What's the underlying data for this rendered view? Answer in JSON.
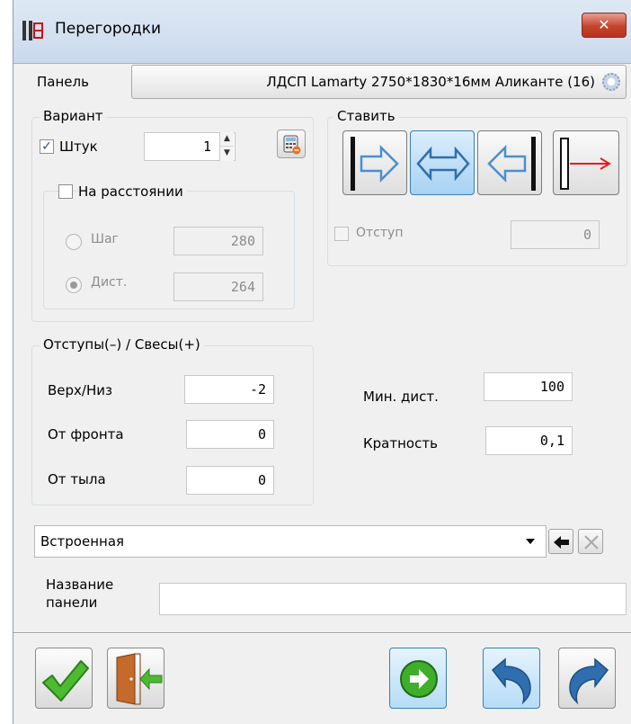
{
  "window": {
    "title": "Перегородки",
    "close_glyph": "✕"
  },
  "panel": {
    "label": "Панель",
    "value": "ЛДСП Lamarty 2750*1830*16мм Аликанте (16)"
  },
  "variant": {
    "title": "Вариант",
    "pieces_label": "Штук",
    "pieces_checked": true,
    "pieces_value": "1",
    "at_distance_label": "На расстоянии",
    "at_distance_checked": false,
    "step_label": "Шаг",
    "step_value": "280",
    "dist_label": "Дист.",
    "dist_value": "264",
    "selected_mode": "dist"
  },
  "place": {
    "title": "Ставить",
    "options": [
      "left-arrow-right",
      "center-both",
      "right-arrow-left",
      "edge-red-arrow"
    ],
    "active_option": "center-both",
    "offset_label": "Отступ",
    "offset_checked": false,
    "offset_value": "0"
  },
  "offsets": {
    "title": "Отступы(–) / Свесы(+)",
    "top_bottom_label": "Верх/Низ",
    "top_bottom_value": "-2",
    "front_label": "От фронта",
    "front_value": "0",
    "back_label": "От тыла",
    "back_value": "0"
  },
  "params": {
    "min_dist_label": "Мин. дист.",
    "min_dist_value": "100",
    "multiplicity_label": "Кратность",
    "multiplicity_value": "0,1"
  },
  "type_select": {
    "selected": "Встроенная"
  },
  "panel_name": {
    "label_line1": "Название",
    "label_line2": "панели",
    "value": ""
  },
  "colors": {
    "accent_blue": "#2f6fb0",
    "ok_green": "#3fae2a",
    "red_arrow": "#e0201a",
    "disabled_gray": "#8c8c8c"
  }
}
